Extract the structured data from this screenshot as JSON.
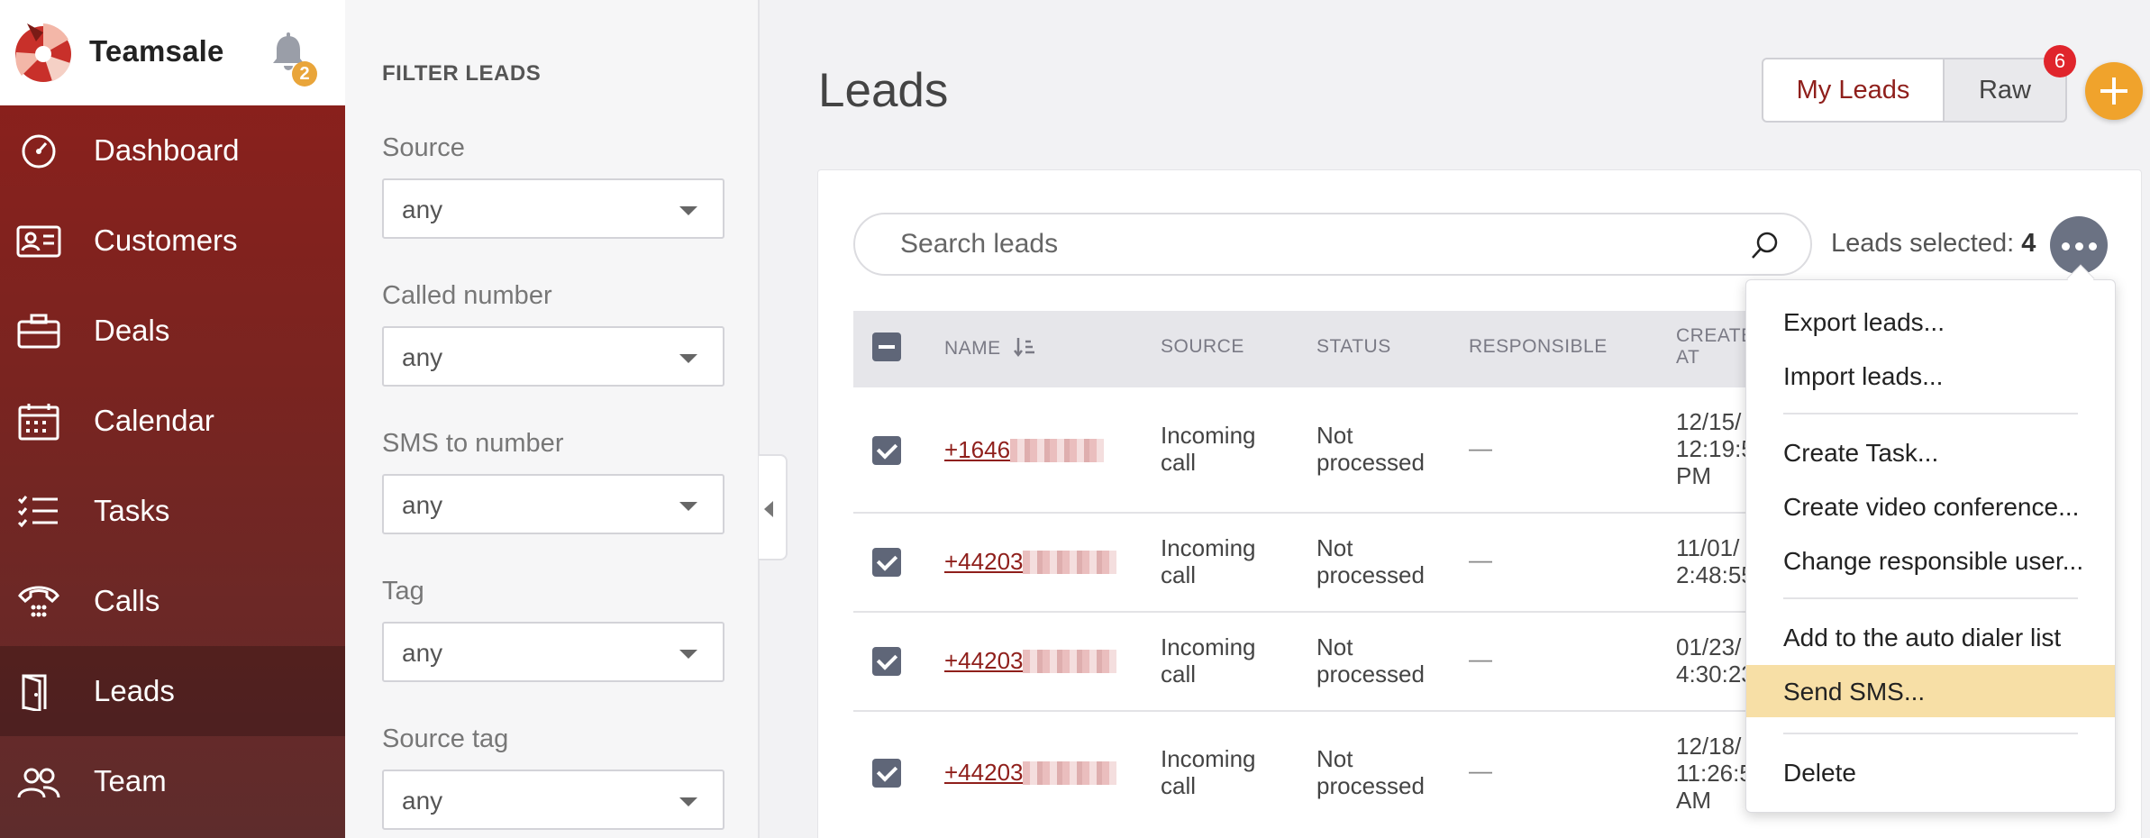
{
  "app": {
    "brand_name": "Teamsale",
    "notifications_count": "2",
    "colors": {
      "brand_red": "#8f1f1b",
      "accent_orange": "#f0a32c",
      "highlight": "#f7dfa6"
    }
  },
  "sidebar": {
    "items": [
      {
        "label": "Dashboard",
        "icon": "gauge-icon"
      },
      {
        "label": "Customers",
        "icon": "contact-card-icon"
      },
      {
        "label": "Deals",
        "icon": "briefcase-icon"
      },
      {
        "label": "Calendar",
        "icon": "calendar-icon"
      },
      {
        "label": "Tasks",
        "icon": "checklist-icon"
      },
      {
        "label": "Calls",
        "icon": "phone-icon"
      },
      {
        "label": "Leads",
        "icon": "door-icon",
        "active": true
      },
      {
        "label": "Team",
        "icon": "people-icon"
      }
    ]
  },
  "filters": {
    "title": "FILTER LEADS",
    "fields": [
      {
        "label": "Source",
        "value": "any"
      },
      {
        "label": "Called number",
        "value": "any"
      },
      {
        "label": "SMS to number",
        "value": "any"
      },
      {
        "label": "Tag",
        "value": "any"
      },
      {
        "label": "Source tag",
        "value": "any"
      }
    ]
  },
  "main": {
    "title": "Leads",
    "toggle": {
      "my_leads": "My Leads",
      "raw": "Raw",
      "raw_badge": "6"
    },
    "search": {
      "placeholder": "Search leads"
    },
    "selection": {
      "label": "Leads selected:",
      "count": "4"
    }
  },
  "table": {
    "headers": {
      "name": "NAME",
      "source": "SOURCE",
      "status": "STATUS",
      "responsible": "RESPONSIBLE",
      "created": "CREATE\nAT"
    },
    "rows": [
      {
        "phone": "+1646",
        "source": "Incoming\ncall",
        "status": "Not\nprocessed",
        "responsible": "—",
        "created": "12/15/\n12:19:5\nPM",
        "checked": true
      },
      {
        "phone": "+44203",
        "source": "Incoming\ncall",
        "status": "Not\nprocessed",
        "responsible": "—",
        "created": "11/01/\n2:48:55",
        "checked": true
      },
      {
        "phone": "+44203",
        "source": "Incoming\ncall",
        "status": "Not\nprocessed",
        "responsible": "—",
        "created": "01/23/\n4:30:23",
        "checked": true
      },
      {
        "phone": "+44203",
        "source": "Incoming\ncall",
        "status": "Not\nprocessed",
        "responsible": "—",
        "created": "12/18/\n11:26:5\nAM",
        "checked": true
      }
    ]
  },
  "actions_menu": {
    "items": [
      "Export leads...",
      "Import leads...",
      "Create Task...",
      "Create video conference...",
      "Change responsible user...",
      "Add to the auto dialer list",
      "Send SMS...",
      "Delete"
    ],
    "highlighted": "Send SMS..."
  }
}
